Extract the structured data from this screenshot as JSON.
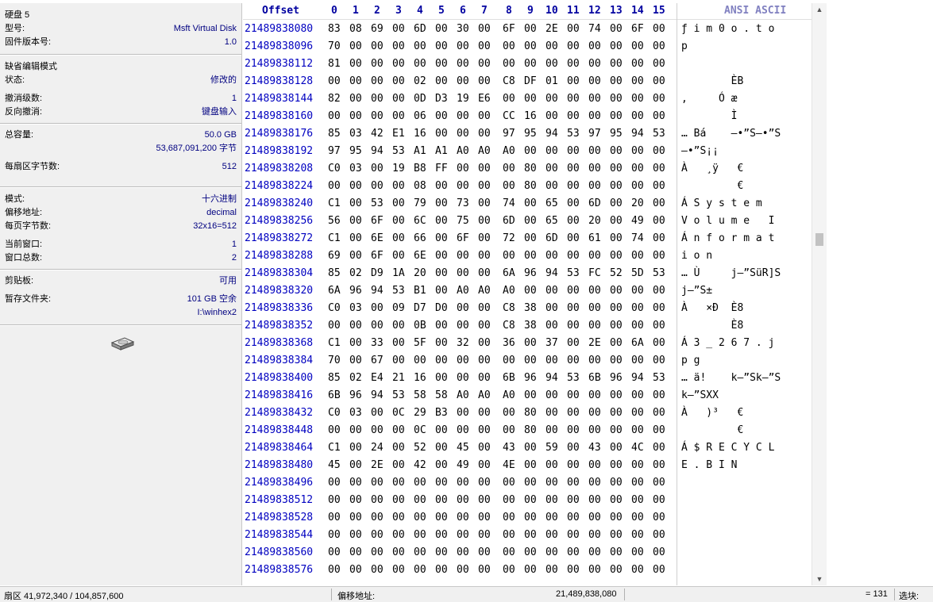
{
  "info_panel": {
    "disk_title": "硬盘 5",
    "model_label": "型号:",
    "model_value": "Msft Virtual Disk",
    "firmware_label": "固件版本号:",
    "firmware_value": "1.0",
    "edit_mode_label": "缺省编辑模式",
    "state_label": "状态:",
    "state_value": "修改的",
    "undo_level_label": "撤消级数:",
    "undo_level_value": "1",
    "reverse_undo_label": "反向撤消:",
    "reverse_undo_value": "键盘输入",
    "capacity_label": "总容量:",
    "capacity_gb": "50.0 GB",
    "capacity_bytes": "53,687,091,200 字节",
    "sector_bytes_label": "每扇区字节数:",
    "sector_bytes_value": "512",
    "mode_label": "模式:",
    "mode_value": "十六进制",
    "offset_label": "偏移地址:",
    "offset_value": "decimal",
    "page_bytes_label": "每页字节数:",
    "page_bytes_value": "32x16=512",
    "current_window_label": "当前窗口:",
    "current_window_value": "1",
    "total_windows_label": "窗口总数:",
    "total_windows_value": "2",
    "clipboard_label": "剪贴板:",
    "clipboard_value": "可用",
    "temp_folder_label": "暂存文件夹:",
    "temp_folder_free": "101 GB 空余",
    "temp_folder_path": "I:\\winhex2",
    "disk_icon": "hard-disk-icon"
  },
  "hex_view": {
    "offset_header": "Offset",
    "column_headers": [
      "0",
      "1",
      "2",
      "3",
      "4",
      "5",
      "6",
      "7",
      "8",
      "9",
      "10",
      "11",
      "12",
      "13",
      "14",
      "15"
    ],
    "ascii_header": "ANSI ASCII",
    "rows": [
      {
        "offset": "21489838080",
        "bytes": [
          "83",
          "08",
          "69",
          "00",
          "6D",
          "00",
          "30",
          "00",
          "6F",
          "00",
          "2E",
          "00",
          "74",
          "00",
          "6F",
          "00"
        ],
        "ascii": "ƒ i m 0 o . t o"
      },
      {
        "offset": "21489838096",
        "bytes": [
          "70",
          "00",
          "00",
          "00",
          "00",
          "00",
          "00",
          "00",
          "00",
          "00",
          "00",
          "00",
          "00",
          "00",
          "00",
          "00"
        ],
        "ascii": "p"
      },
      {
        "offset": "21489838112",
        "bytes": [
          "81",
          "00",
          "00",
          "00",
          "00",
          "00",
          "00",
          "00",
          "00",
          "00",
          "00",
          "00",
          "00",
          "00",
          "00",
          "00"
        ],
        "ascii": ""
      },
      {
        "offset": "21489838128",
        "bytes": [
          "00",
          "00",
          "00",
          "00",
          "02",
          "00",
          "00",
          "00",
          "C8",
          "DF",
          "01",
          "00",
          "00",
          "00",
          "00",
          "00"
        ],
        "ascii": "        ÈB"
      },
      {
        "offset": "21489838144",
        "bytes": [
          "82",
          "00",
          "00",
          "00",
          "0D",
          "D3",
          "19",
          "E6",
          "00",
          "00",
          "00",
          "00",
          "00",
          "00",
          "00",
          "00"
        ],
        "ascii": ",     Ó æ"
      },
      {
        "offset": "21489838160",
        "bytes": [
          "00",
          "00",
          "00",
          "00",
          "06",
          "00",
          "00",
          "00",
          "CC",
          "16",
          "00",
          "00",
          "00",
          "00",
          "00",
          "00"
        ],
        "ascii": "        Ì"
      },
      {
        "offset": "21489838176",
        "bytes": [
          "85",
          "03",
          "42",
          "E1",
          "16",
          "00",
          "00",
          "00",
          "97",
          "95",
          "94",
          "53",
          "97",
          "95",
          "94",
          "53"
        ],
        "ascii": "… Bá    —•”S—•”S"
      },
      {
        "offset": "21489838192",
        "bytes": [
          "97",
          "95",
          "94",
          "53",
          "A1",
          "A1",
          "A0",
          "A0",
          "A0",
          "00",
          "00",
          "00",
          "00",
          "00",
          "00",
          "00"
        ],
        "ascii": "—•”S¡¡"
      },
      {
        "offset": "21489838208",
        "bytes": [
          "C0",
          "03",
          "00",
          "19",
          "B8",
          "FF",
          "00",
          "00",
          "00",
          "80",
          "00",
          "00",
          "00",
          "00",
          "00",
          "00"
        ],
        "ascii": "À   ¸ÿ   €"
      },
      {
        "offset": "21489838224",
        "bytes": [
          "00",
          "00",
          "00",
          "00",
          "08",
          "00",
          "00",
          "00",
          "00",
          "80",
          "00",
          "00",
          "00",
          "00",
          "00",
          "00"
        ],
        "ascii": "         €"
      },
      {
        "offset": "21489838240",
        "bytes": [
          "C1",
          "00",
          "53",
          "00",
          "79",
          "00",
          "73",
          "00",
          "74",
          "00",
          "65",
          "00",
          "6D",
          "00",
          "20",
          "00"
        ],
        "ascii": "Á S y s t e m"
      },
      {
        "offset": "21489838256",
        "bytes": [
          "56",
          "00",
          "6F",
          "00",
          "6C",
          "00",
          "75",
          "00",
          "6D",
          "00",
          "65",
          "00",
          "20",
          "00",
          "49",
          "00"
        ],
        "ascii": "V o l u m e   I"
      },
      {
        "offset": "21489838272",
        "bytes": [
          "C1",
          "00",
          "6E",
          "00",
          "66",
          "00",
          "6F",
          "00",
          "72",
          "00",
          "6D",
          "00",
          "61",
          "00",
          "74",
          "00"
        ],
        "ascii": "Á n f o r m a t"
      },
      {
        "offset": "21489838288",
        "bytes": [
          "69",
          "00",
          "6F",
          "00",
          "6E",
          "00",
          "00",
          "00",
          "00",
          "00",
          "00",
          "00",
          "00",
          "00",
          "00",
          "00"
        ],
        "ascii": "i o n"
      },
      {
        "offset": "21489838304",
        "bytes": [
          "85",
          "02",
          "D9",
          "1A",
          "20",
          "00",
          "00",
          "00",
          "6A",
          "96",
          "94",
          "53",
          "FC",
          "52",
          "5D",
          "53"
        ],
        "ascii": "… Ù     j–”SüR]S"
      },
      {
        "offset": "21489838320",
        "bytes": [
          "6A",
          "96",
          "94",
          "53",
          "B1",
          "00",
          "A0",
          "A0",
          "A0",
          "00",
          "00",
          "00",
          "00",
          "00",
          "00",
          "00"
        ],
        "ascii": "j–”S±"
      },
      {
        "offset": "21489838336",
        "bytes": [
          "C0",
          "03",
          "00",
          "09",
          "D7",
          "D0",
          "00",
          "00",
          "C8",
          "38",
          "00",
          "00",
          "00",
          "00",
          "00",
          "00"
        ],
        "ascii": "À   ×Ð  È8"
      },
      {
        "offset": "21489838352",
        "bytes": [
          "00",
          "00",
          "00",
          "00",
          "0B",
          "00",
          "00",
          "00",
          "C8",
          "38",
          "00",
          "00",
          "00",
          "00",
          "00",
          "00"
        ],
        "ascii": "        È8"
      },
      {
        "offset": "21489838368",
        "bytes": [
          "C1",
          "00",
          "33",
          "00",
          "5F",
          "00",
          "32",
          "00",
          "36",
          "00",
          "37",
          "00",
          "2E",
          "00",
          "6A",
          "00"
        ],
        "ascii": "Á 3 _ 2 6 7 . j"
      },
      {
        "offset": "21489838384",
        "bytes": [
          "70",
          "00",
          "67",
          "00",
          "00",
          "00",
          "00",
          "00",
          "00",
          "00",
          "00",
          "00",
          "00",
          "00",
          "00",
          "00"
        ],
        "ascii": "p g"
      },
      {
        "offset": "21489838400",
        "bytes": [
          "85",
          "02",
          "E4",
          "21",
          "16",
          "00",
          "00",
          "00",
          "6B",
          "96",
          "94",
          "53",
          "6B",
          "96",
          "94",
          "53"
        ],
        "ascii": "… ä!    k–”Sk–”S"
      },
      {
        "offset": "21489838416",
        "bytes": [
          "6B",
          "96",
          "94",
          "53",
          "58",
          "58",
          "A0",
          "A0",
          "A0",
          "00",
          "00",
          "00",
          "00",
          "00",
          "00",
          "00"
        ],
        "ascii": "k–”SXX"
      },
      {
        "offset": "21489838432",
        "bytes": [
          "C0",
          "03",
          "00",
          "0C",
          "29",
          "B3",
          "00",
          "00",
          "00",
          "80",
          "00",
          "00",
          "00",
          "00",
          "00",
          "00"
        ],
        "ascii": "À   )³   €"
      },
      {
        "offset": "21489838448",
        "bytes": [
          "00",
          "00",
          "00",
          "00",
          "0C",
          "00",
          "00",
          "00",
          "00",
          "80",
          "00",
          "00",
          "00",
          "00",
          "00",
          "00"
        ],
        "ascii": "         €"
      },
      {
        "offset": "21489838464",
        "bytes": [
          "C1",
          "00",
          "24",
          "00",
          "52",
          "00",
          "45",
          "00",
          "43",
          "00",
          "59",
          "00",
          "43",
          "00",
          "4C",
          "00"
        ],
        "ascii": "Á $ R E C Y C L"
      },
      {
        "offset": "21489838480",
        "bytes": [
          "45",
          "00",
          "2E",
          "00",
          "42",
          "00",
          "49",
          "00",
          "4E",
          "00",
          "00",
          "00",
          "00",
          "00",
          "00",
          "00"
        ],
        "ascii": "E . B I N"
      },
      {
        "offset": "21489838496",
        "bytes": [
          "00",
          "00",
          "00",
          "00",
          "00",
          "00",
          "00",
          "00",
          "00",
          "00",
          "00",
          "00",
          "00",
          "00",
          "00",
          "00"
        ],
        "ascii": ""
      },
      {
        "offset": "21489838512",
        "bytes": [
          "00",
          "00",
          "00",
          "00",
          "00",
          "00",
          "00",
          "00",
          "00",
          "00",
          "00",
          "00",
          "00",
          "00",
          "00",
          "00"
        ],
        "ascii": ""
      },
      {
        "offset": "21489838528",
        "bytes": [
          "00",
          "00",
          "00",
          "00",
          "00",
          "00",
          "00",
          "00",
          "00",
          "00",
          "00",
          "00",
          "00",
          "00",
          "00",
          "00"
        ],
        "ascii": ""
      },
      {
        "offset": "21489838544",
        "bytes": [
          "00",
          "00",
          "00",
          "00",
          "00",
          "00",
          "00",
          "00",
          "00",
          "00",
          "00",
          "00",
          "00",
          "00",
          "00",
          "00"
        ],
        "ascii": ""
      },
      {
        "offset": "21489838560",
        "bytes": [
          "00",
          "00",
          "00",
          "00",
          "00",
          "00",
          "00",
          "00",
          "00",
          "00",
          "00",
          "00",
          "00",
          "00",
          "00",
          "00"
        ],
        "ascii": ""
      },
      {
        "offset": "21489838576",
        "bytes": [
          "00",
          "00",
          "00",
          "00",
          "00",
          "00",
          "00",
          "00",
          "00",
          "00",
          "00",
          "00",
          "00",
          "00",
          "00",
          "00"
        ],
        "ascii": ""
      }
    ]
  },
  "scrollbar": {
    "up_icon": "chevron-up-icon",
    "down_icon": "chevron-down-icon"
  },
  "status_bar": {
    "sector_text": "扇区 41,972,340 / 104,857,600",
    "offset_label": "偏移地址:",
    "offset_value": "21,489,838,080",
    "value_text": "= 131",
    "selection_label": "选块:"
  },
  "colors": {
    "offset_blue": "#0000c0",
    "header_blue": "#0000a0",
    "panel_bg": "#f0f0f0"
  }
}
